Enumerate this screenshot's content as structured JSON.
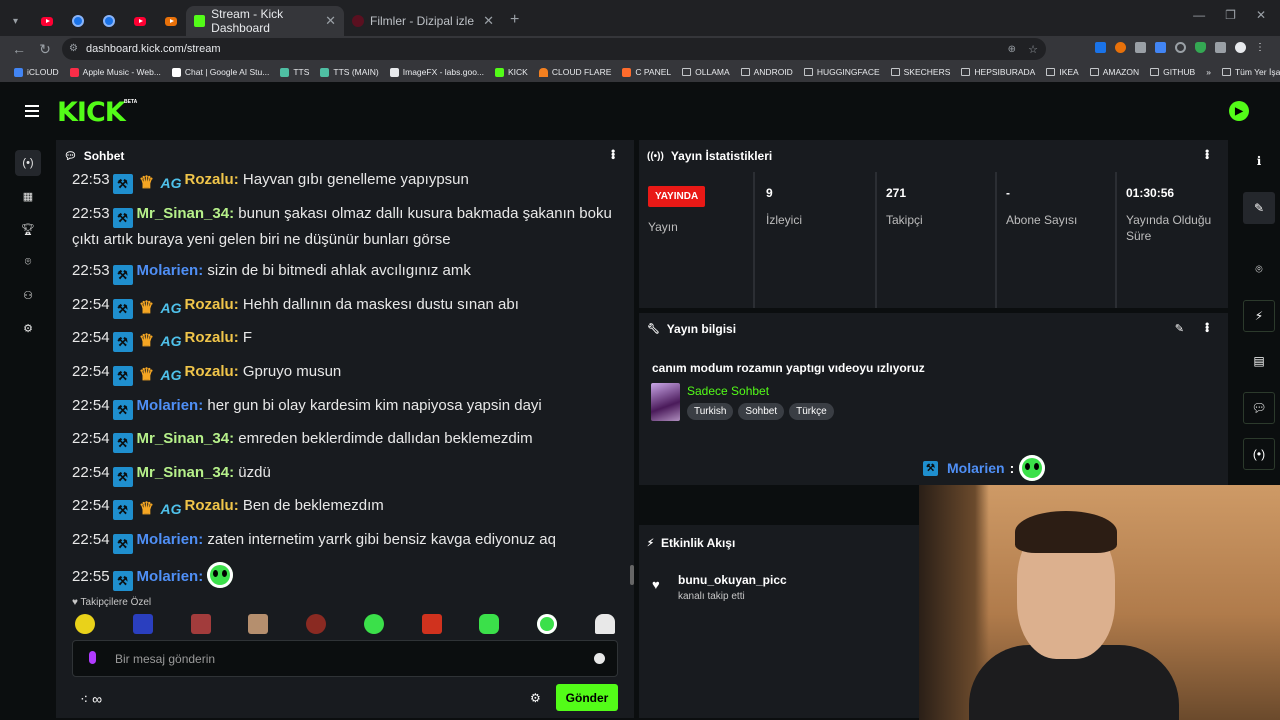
{
  "browser": {
    "tabs": [
      {
        "title": "Stream - Kick Dashboard",
        "active": true
      },
      {
        "title": "Filmler - Dizipal izle",
        "active": false
      }
    ],
    "url": "dashboard.kick.com/stream",
    "bookmarks": [
      "iCLOUD",
      "Apple Music - Web...",
      "Chat | Google AI Stu...",
      "TTS",
      "TTS (MAIN)",
      "ImageFX - labs.goo...",
      "KICK",
      "CLOUD FLARE",
      "C PANEL",
      "OLLAMA",
      "ANDROID",
      "HUGGINGFACE",
      "SKECHERS",
      "HEPSIBURADA",
      "IKEA",
      "AMAZON",
      "GITHUB"
    ],
    "bookmarks_more": "»",
    "all_bookmarks": "Tüm Yer İşaretleri"
  },
  "app": {
    "logo": "KICK",
    "beta": "BETA"
  },
  "chat": {
    "title": "Sohbet",
    "messages": [
      {
        "time": "22:53",
        "user": "Rozalu",
        "color": "#f0c54a",
        "badges": [
          "mod",
          "crown",
          "ag"
        ],
        "text": "Hayvan gıbı genelleme yapıypsun"
      },
      {
        "time": "22:53",
        "user": "Mr_Sinan_34",
        "color": "#b6f08a",
        "badges": [
          "mod"
        ],
        "text": "bunun şakası olmaz dallı kusura bakmada şakanın boku çıktı artık buraya yeni gelen biri ne düşünür bunları görse"
      },
      {
        "time": "22:53",
        "user": "Molarien",
        "color": "#4f8ff5",
        "badges": [
          "mod"
        ],
        "text": "sizin de bi bitmedi ahlak avcılıgınız amk"
      },
      {
        "time": "22:54",
        "user": "Rozalu",
        "color": "#f0c54a",
        "badges": [
          "mod",
          "crown",
          "ag"
        ],
        "text": "Hehh dallının da maskesı dustu sınan abı"
      },
      {
        "time": "22:54",
        "user": "Rozalu",
        "color": "#f0c54a",
        "badges": [
          "mod",
          "crown",
          "ag"
        ],
        "text": "F"
      },
      {
        "time": "22:54",
        "user": "Rozalu",
        "color": "#f0c54a",
        "badges": [
          "mod",
          "crown",
          "ag"
        ],
        "text": "Gpruyo musun"
      },
      {
        "time": "22:54",
        "user": "Molarien",
        "color": "#4f8ff5",
        "badges": [
          "mod"
        ],
        "text": "her gun bi olay kardesim kim napiyosa yapsin dayi"
      },
      {
        "time": "22:54",
        "user": "Mr_Sinan_34",
        "color": "#b6f08a",
        "badges": [
          "mod"
        ],
        "text": "emreden beklerdimde dallıdan beklemezdim"
      },
      {
        "time": "22:54",
        "user": "Mr_Sinan_34",
        "color": "#b6f08a",
        "badges": [
          "mod"
        ],
        "text": "üzdü"
      },
      {
        "time": "22:54",
        "user": "Rozalu",
        "color": "#f0c54a",
        "badges": [
          "mod",
          "crown",
          "ag"
        ],
        "text": "Ben de beklemezdım"
      },
      {
        "time": "22:54",
        "user": "Molarien",
        "color": "#4f8ff5",
        "badges": [
          "mod"
        ],
        "text": "zaten internetim yarrk gibi bensiz kavga ediyonuz aq"
      },
      {
        "time": "22:55",
        "user": "Molarien",
        "color": "#4f8ff5",
        "badges": [
          "mod"
        ],
        "text": "",
        "emote": true
      }
    ],
    "followers_only_label": "Takipçilere Özel",
    "input_placeholder": "Bir mesaj gönderin",
    "send_label": "Gönder",
    "infinity": "∞"
  },
  "stats": {
    "title": "Yayın İstatistikleri",
    "live_badge": "YAYINDA",
    "cells": [
      {
        "value": "",
        "label": "Yayın"
      },
      {
        "value": "9",
        "label": "İzleyici"
      },
      {
        "value": "271",
        "label": "Takipçi"
      },
      {
        "value": "-",
        "label": "Abone Sayısı"
      },
      {
        "value": "01:30:56",
        "label": "Yayında Olduğu Süre"
      }
    ]
  },
  "info": {
    "title": "Yayın bilgisi",
    "stream_title": "canım modum rozamın yaptıgı vıdeoyu ızlıyoruz",
    "category": "Sadece Sohbet",
    "tags": [
      "Turkish",
      "Sohbet",
      "Türkçe"
    ]
  },
  "overlay": {
    "user": "Molarien",
    "sep": ":"
  },
  "activity": {
    "title": "Etkinlik Akışı",
    "items": [
      {
        "user": "bunu_okuyan_picc",
        "text": "kanalı takip etti"
      }
    ]
  },
  "colors": {
    "brand": "#53fc18",
    "live": "#e91916"
  }
}
